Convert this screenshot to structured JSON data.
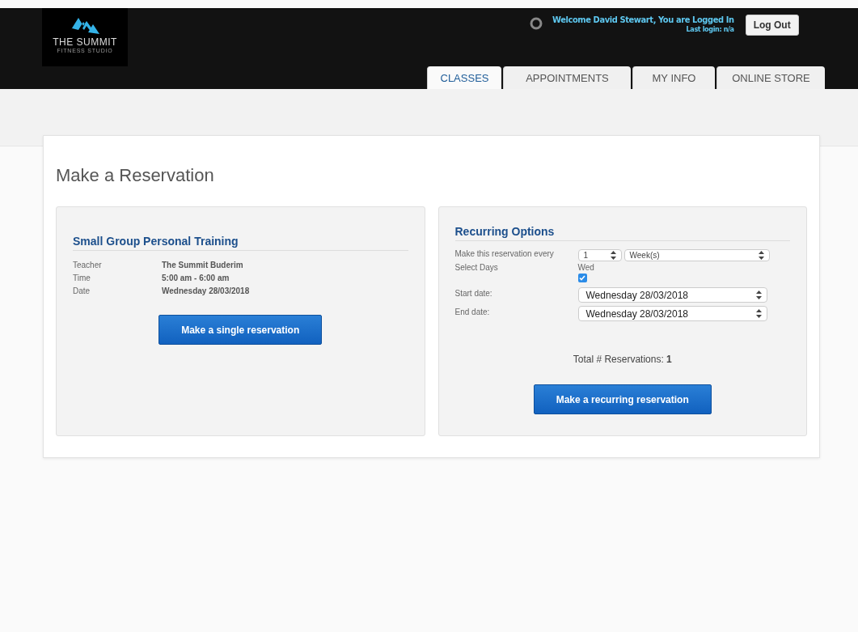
{
  "header": {
    "logo": {
      "name": "THE SUMMIT",
      "tagline": "FITNESS STUDIO"
    },
    "welcome": "Welcome David Stewart, You are Logged In",
    "last_login": "Last login: n/a",
    "logout": "Log Out"
  },
  "tabs": [
    {
      "label": "CLASSES",
      "selected": true
    },
    {
      "label": "APPOINTMENTS",
      "selected": false
    },
    {
      "label": "MY INFO",
      "selected": false
    },
    {
      "label": "ONLINE STORE",
      "selected": false
    }
  ],
  "page_title": "Make a Reservation",
  "class_panel": {
    "title": "Small Group Personal Training",
    "details": [
      {
        "label": "Teacher",
        "value": "The Summit Buderim"
      },
      {
        "label": "Time",
        "value": "5:00 am - 6:00 am"
      },
      {
        "label": "Date",
        "value": "Wednesday 28/03/2018"
      }
    ],
    "button": "Make a single reservation"
  },
  "recurring_panel": {
    "title": "Recurring Options",
    "every_label": "Make this reservation every",
    "every_count": "1",
    "every_unit": "Week(s)",
    "days_label": "Select Days",
    "days": [
      {
        "label": "Wed",
        "checked": true
      }
    ],
    "start_label": "Start date:",
    "start_value": "Wednesday 28/03/2018",
    "end_label": "End date:",
    "end_value": "Wednesday 28/03/2018",
    "total": "Total # Reservations: **1**",
    "button": "Make a recurring reservation"
  }
}
